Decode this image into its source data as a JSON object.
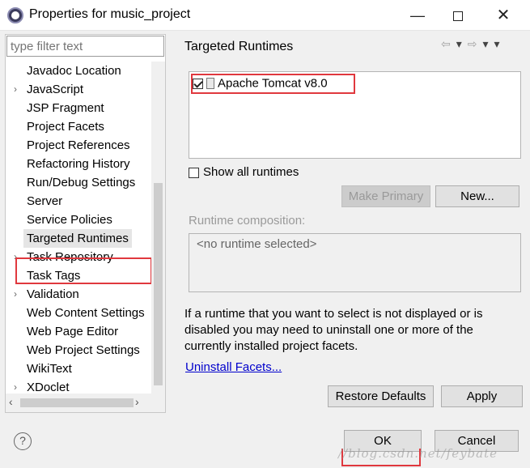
{
  "window": {
    "title": "Properties for music_project",
    "minimize": "—",
    "close": "✕"
  },
  "filter": {
    "placeholder": "type filter text"
  },
  "tree": {
    "items": [
      {
        "label": "Javadoc Location",
        "expandable": false
      },
      {
        "label": "JavaScript",
        "expandable": true
      },
      {
        "label": "JSP Fragment",
        "expandable": false
      },
      {
        "label": "Project Facets",
        "expandable": false
      },
      {
        "label": "Project References",
        "expandable": false
      },
      {
        "label": "Refactoring History",
        "expandable": false
      },
      {
        "label": "Run/Debug Settings",
        "expandable": false
      },
      {
        "label": "Server",
        "expandable": false
      },
      {
        "label": "Service Policies",
        "expandable": false
      },
      {
        "label": "Targeted Runtimes",
        "expandable": false,
        "selected": true
      },
      {
        "label": "Task Repository",
        "expandable": true
      },
      {
        "label": "Task Tags",
        "expandable": false
      },
      {
        "label": "Validation",
        "expandable": true
      },
      {
        "label": "Web Content Settings",
        "expandable": false
      },
      {
        "label": "Web Page Editor",
        "expandable": false
      },
      {
        "label": "Web Project Settings",
        "expandable": false
      },
      {
        "label": "WikiText",
        "expandable": false
      },
      {
        "label": "XDoclet",
        "expandable": true
      }
    ]
  },
  "page": {
    "title": "Targeted Runtimes",
    "nav": {
      "back": "⇦",
      "back_menu": "▾",
      "forward": "⇨",
      "forward_menu": "▾",
      "view_menu": "▾"
    },
    "runtimes": [
      {
        "label": "Apache Tomcat v8.0",
        "checked": true
      }
    ],
    "show_all_label": "Show all runtimes",
    "make_primary_label": "Make Primary",
    "new_label": "New...",
    "composition_label": "Runtime composition:",
    "composition_value": "<no runtime selected>",
    "info_text": "If a runtime that you want to select is not displayed or is disabled you may need to uninstall one or more of the currently installed project facets.",
    "uninstall_link": "Uninstall Facets...",
    "restore_label": "Restore Defaults",
    "apply_label": "Apply"
  },
  "footer": {
    "help": "?",
    "ok_label": "OK",
    "cancel_label": "Cancel",
    "watermark": "//blog.csdn.net/feybate"
  },
  "colors": {
    "highlight_box": "#e0383e",
    "link": "#0000cc"
  }
}
